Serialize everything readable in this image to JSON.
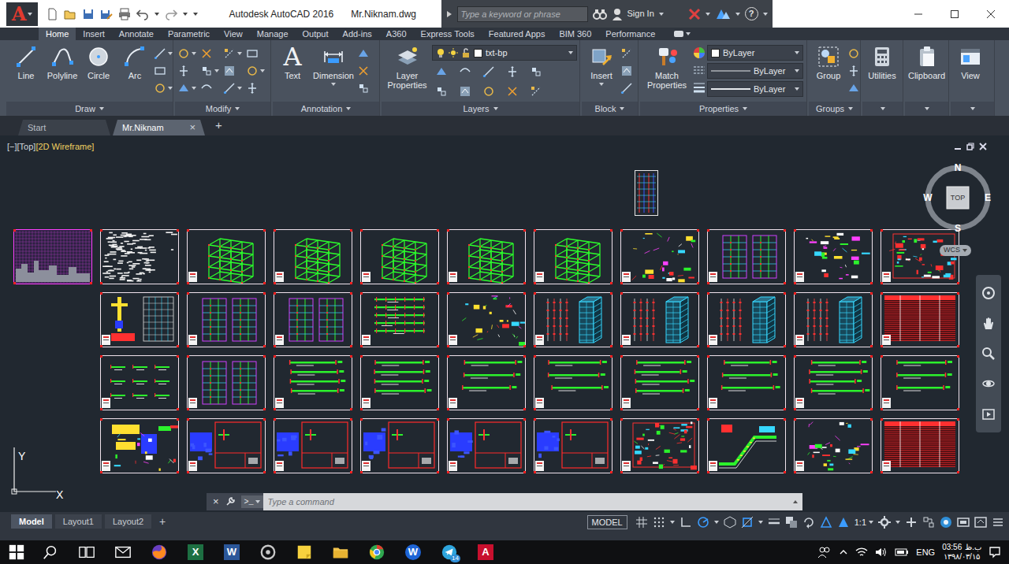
{
  "window": {
    "logo": "A",
    "title": "Autodesk AutoCAD 2016",
    "file": "Mr.Niknam.dwg"
  },
  "infocenter": {
    "search_placeholder": "Type a keyword or phrase",
    "sign_in": "Sign In",
    "help": "?"
  },
  "ribbon": {
    "tabs": [
      {
        "label": "Home",
        "selected": true
      },
      {
        "label": "Insert",
        "selected": false
      },
      {
        "label": "Annotate",
        "selected": false
      },
      {
        "label": "Parametric",
        "selected": false
      },
      {
        "label": "View",
        "selected": false
      },
      {
        "label": "Manage",
        "selected": false
      },
      {
        "label": "Output",
        "selected": false
      },
      {
        "label": "Add-ins",
        "selected": false
      },
      {
        "label": "A360",
        "selected": false
      },
      {
        "label": "Express Tools",
        "selected": false
      },
      {
        "label": "Featured Apps",
        "selected": false
      },
      {
        "label": "BIM 360",
        "selected": false
      },
      {
        "label": "Performance",
        "selected": false
      }
    ],
    "panels": [
      {
        "title": "Draw",
        "tools": [
          "Line",
          "Polyline",
          "Circle",
          "Arc"
        ]
      },
      {
        "title": "Modify",
        "tools": []
      },
      {
        "title": "Annotation",
        "tools": [
          "Text",
          "Dimension"
        ],
        "text_glyph": "A"
      },
      {
        "title": "Layers",
        "tools": [
          "Layer Properties"
        ],
        "layer": "txt-bp"
      },
      {
        "title": "Block",
        "tools": [
          "Insert"
        ]
      },
      {
        "title": "Properties",
        "tools": [
          "Match Properties"
        ],
        "dropdowns": [
          "ByLayer",
          "ByLayer",
          "ByLayer"
        ]
      },
      {
        "title": "Groups",
        "tools": [
          "Group"
        ]
      },
      {
        "tools": [
          "Utilities"
        ]
      },
      {
        "tools": [
          "Clipboard"
        ]
      },
      {
        "tools": [
          "View"
        ]
      }
    ]
  },
  "file_tabs": {
    "tabs": [
      {
        "label": "Start",
        "selected": false
      },
      {
        "label": "Mr.Niknam",
        "selected": true,
        "close": "×"
      }
    ],
    "add": "+"
  },
  "viewport": {
    "labels": [
      "[−]",
      "[Top]",
      "[2D Wireframe]"
    ]
  },
  "viewcube": {
    "face": "TOP",
    "north": "N",
    "south": "S",
    "east": "E",
    "west": "W",
    "ucs": "WCS"
  },
  "ucs_icon": {
    "x": "X",
    "y": "Y"
  },
  "sheets": {
    "top": {
      "kind": "tower-small"
    },
    "rows": [
      [
        {
          "kind": "cover"
        },
        {
          "kind": "notes"
        },
        {
          "kind": "frame3d"
        },
        {
          "kind": "frame3d"
        },
        {
          "kind": "frame3d"
        },
        {
          "kind": "frame3d"
        },
        {
          "kind": "frame3d"
        },
        {
          "kind": "detail"
        },
        {
          "kind": "elevation"
        },
        {
          "kind": "detail"
        },
        {
          "kind": "detail-red"
        }
      ],
      [
        {
          "kind": "section"
        },
        {
          "kind": "elevation"
        },
        {
          "kind": "elevation"
        },
        {
          "kind": "beam-red"
        },
        {
          "kind": "detail"
        },
        {
          "kind": "tower"
        },
        {
          "kind": "tower"
        },
        {
          "kind": "tower"
        },
        {
          "kind": "tower"
        },
        {
          "kind": "table-red"
        }
      ],
      [
        {
          "kind": "beam-small"
        },
        {
          "kind": "elevation"
        },
        {
          "kind": "beam"
        },
        {
          "kind": "beam"
        },
        {
          "kind": "beam"
        },
        {
          "kind": "beam"
        },
        {
          "kind": "beam"
        },
        {
          "kind": "beam"
        },
        {
          "kind": "beam"
        },
        {
          "kind": "beam"
        }
      ],
      [
        {
          "kind": "detail-yellow"
        },
        {
          "kind": "plan-red"
        },
        {
          "kind": "plan-red"
        },
        {
          "kind": "plan-red"
        },
        {
          "kind": "plan-red"
        },
        {
          "kind": "plan-red"
        },
        {
          "kind": "detail-red"
        },
        {
          "kind": "stair"
        },
        {
          "kind": "detail"
        },
        {
          "kind": "table-red"
        }
      ]
    ]
  },
  "command_line": {
    "close": "×",
    "prompt": ">_",
    "placeholder": "Type a command"
  },
  "layout_tabs": {
    "tabs": [
      {
        "label": "Model",
        "selected": true
      },
      {
        "label": "Layout1",
        "selected": false
      },
      {
        "label": "Layout2",
        "selected": false
      }
    ],
    "add": "+"
  },
  "status_bar": {
    "space": "MODEL",
    "scale": "1:1"
  },
  "taskbar": {
    "apps": [
      {
        "kind": "start"
      },
      {
        "kind": "search"
      },
      {
        "kind": "task-view"
      },
      {
        "kind": "mail"
      },
      {
        "kind": "firefox"
      },
      {
        "kind": "excel",
        "glyph": "X"
      },
      {
        "kind": "word",
        "glyph": "W"
      },
      {
        "kind": "media"
      },
      {
        "kind": "sticky"
      },
      {
        "kind": "explorer"
      },
      {
        "kind": "browser"
      },
      {
        "kind": "wps",
        "glyph": "W"
      },
      {
        "kind": "telegram",
        "badge": "14"
      },
      {
        "kind": "autocad",
        "glyph": "A"
      }
    ],
    "language": "ENG",
    "time": "03:56",
    "period": "ب.ظ",
    "date": "۱۳۹۸/۰۳/۱۵"
  }
}
